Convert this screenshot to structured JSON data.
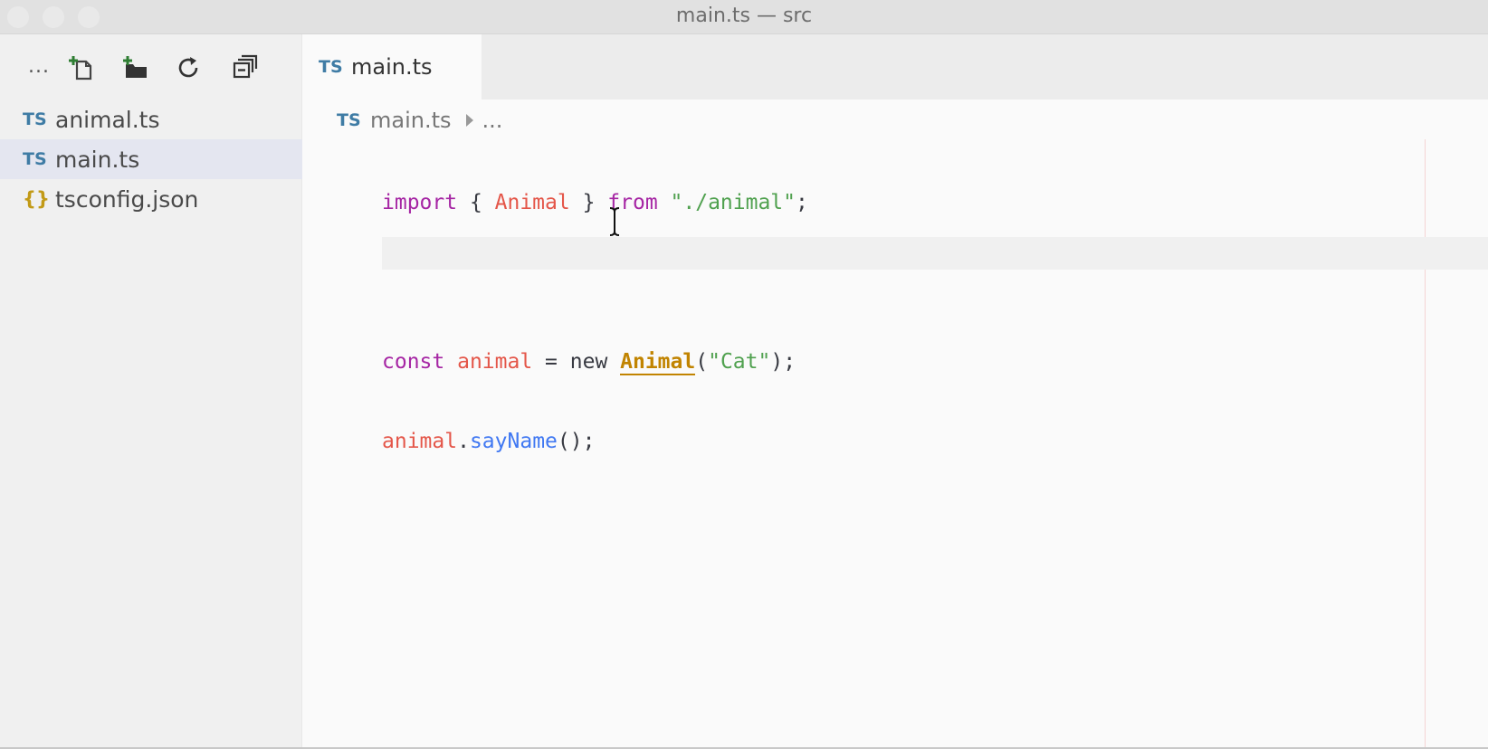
{
  "window": {
    "title": "main.ts — src"
  },
  "sidebar": {
    "toolbar": {
      "more_label": "...",
      "icons": [
        "new-file-icon",
        "new-folder-icon",
        "refresh-icon",
        "collapse-all-icon"
      ]
    },
    "files": [
      {
        "badge": "TS",
        "name": "animal.ts",
        "selected": false
      },
      {
        "badge": "TS",
        "name": "main.ts",
        "selected": true
      },
      {
        "badge": "{}",
        "name": "tsconfig.json",
        "selected": false
      }
    ]
  },
  "tabs": [
    {
      "badge": "TS",
      "label": "main.ts",
      "active": true
    }
  ],
  "breadcrumb": {
    "badge": "TS",
    "file": "main.ts",
    "more": "..."
  },
  "editor": {
    "lines": [
      {
        "t1": "import",
        "t2": " { ",
        "t3": "Animal",
        "t4": " } ",
        "t5": "from",
        "t6": " ",
        "t7": "\"./animal\"",
        "t8": ";"
      },
      {
        "empty": ""
      },
      {
        "t1": "const",
        "t2": " ",
        "t3": "animal",
        "t4": " = new ",
        "t5": "Animal",
        "t6": "(",
        "t7": "\"Cat\"",
        "t8": ");"
      },
      {
        "t1": "animal",
        "t2": ".",
        "t3": "sayName",
        "t4": "();"
      }
    ]
  },
  "colors": {
    "keyword": "#a626a4",
    "variable": "#e45649",
    "string": "#50a14f",
    "function": "#4078f2",
    "class": "#c18401",
    "ts_badge": "#3f7ca5",
    "json_badge": "#c29a17"
  }
}
